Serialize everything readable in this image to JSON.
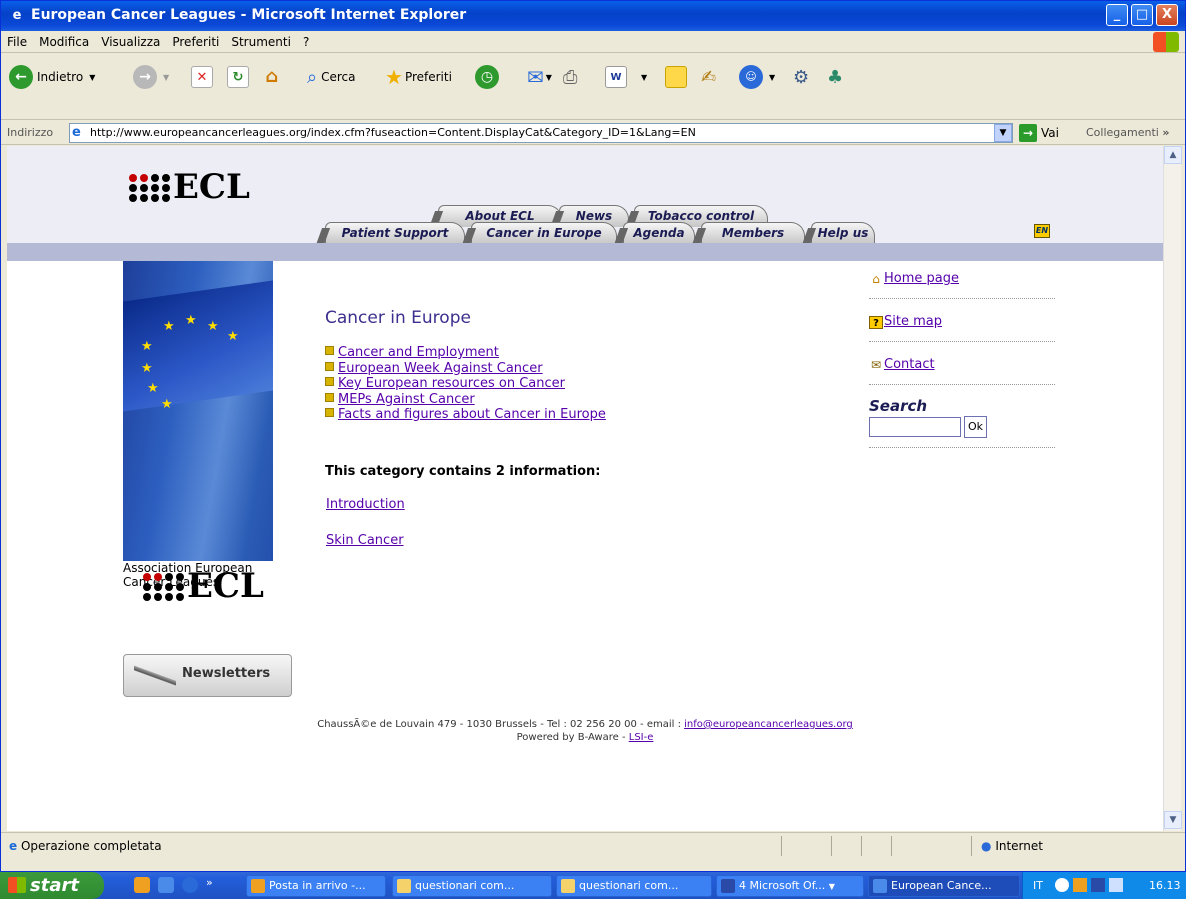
{
  "window": {
    "title": "European Cancer Leagues - Microsoft Internet Explorer",
    "controls": [
      "_",
      "□",
      "X"
    ]
  },
  "menubar": [
    "File",
    "Modifica",
    "Visualizza",
    "Preferiti",
    "Strumenti",
    "?"
  ],
  "toolbar": {
    "back_label": "Indietro",
    "search_label": "Cerca",
    "favorites_label": "Preferiti"
  },
  "addressbar": {
    "label": "Indirizzo",
    "url": "http://www.europeancancerleagues.org/index.cfm?fuseaction=Content.DisplayCat&Category_ID=1&Lang=EN",
    "go_label": "Vai",
    "links_label": "Collegamenti"
  },
  "site": {
    "logo_text": "ECL",
    "logo_sub1": "Association European",
    "logo_sub2": "Cancer Leagues",
    "nav_top": [
      "About ECL",
      "News",
      "Tobacco control"
    ],
    "nav_bottom": [
      "Patient Support",
      "Cancer in Europe",
      "Agenda",
      "Members",
      "Help us"
    ],
    "lang": "EN",
    "newsletters_label": "Newsletters"
  },
  "main": {
    "heading": "Cancer in Europe",
    "links": [
      "Cancer and Employment",
      "European Week Against Cancer",
      "Key European resources on Cancer",
      "MEPs Against Cancer",
      "Facts and figures about Cancer in Europe"
    ],
    "count_text": "This category contains 2 information:",
    "items": [
      "Introduction",
      "Skin Cancer"
    ]
  },
  "sidebar": {
    "home": "Home page",
    "sitemap": "Site map",
    "contact": "Contact",
    "search_label": "Search",
    "search_button": "Ok"
  },
  "footer": {
    "line1_pre": "ChaussÃ©e de Louvain 479 - 1030 Brussels - Tel : 02 256 20 00 - email : ",
    "email": "info@europeancancerleagues.org",
    "line2_pre": "Powered by B-Aware - ",
    "line2_link": "LSI-e"
  },
  "status": {
    "text": "Operazione completata",
    "zone": "Internet"
  },
  "taskbar": {
    "start": "start",
    "tasks": [
      "Posta in arrivo -...",
      "questionari com...",
      "questionari com...",
      "4 Microsoft Of...",
      "European Cance..."
    ],
    "lang": "IT",
    "clock": "16.13"
  }
}
